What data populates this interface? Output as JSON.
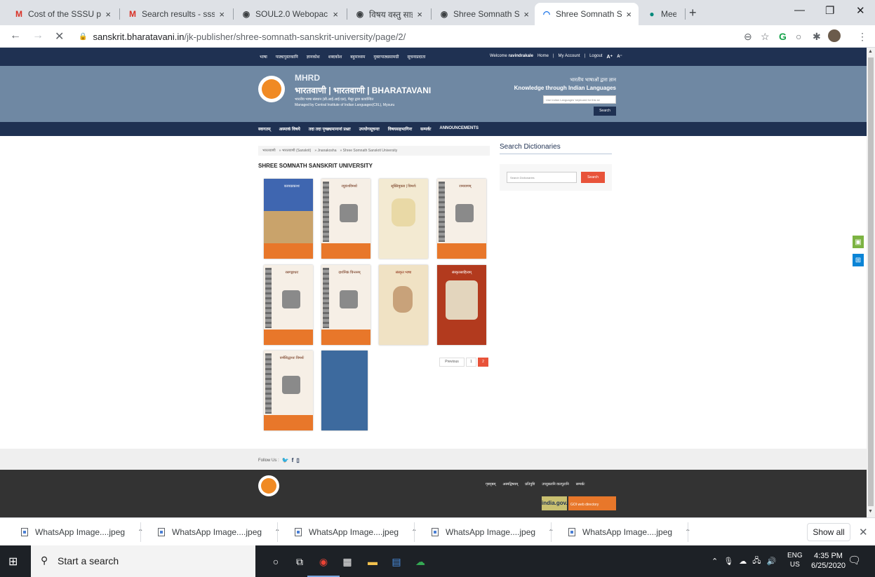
{
  "browser": {
    "tabs": [
      {
        "title": "Cost of the SSSU pu",
        "icon": "gmail-icon"
      },
      {
        "title": "Search results - sssu",
        "icon": "gmail-icon"
      },
      {
        "title": "SOUL2.0 Webopac",
        "icon": "globe-icon"
      },
      {
        "title": "विषय वस्तु साझीदार | C",
        "icon": "globe-icon"
      },
      {
        "title": "Shree Somnath Sans",
        "icon": "globe-icon"
      },
      {
        "title": "Shree Somnath Sans",
        "icon": "loading-icon",
        "active": true
      },
      {
        "title": "Meet – yoi-ngd",
        "icon": "meet-icon"
      }
    ],
    "url_domain": "sanskrit.bharatavani.in",
    "url_path": "/jk-publisher/shree-somnath-sanskrit-university/page/2/",
    "new_tab": "+",
    "close_tab": "×"
  },
  "site": {
    "top_links": [
      "भाषा",
      "पाठ्यपुस्तकानि",
      "ज्ञानकोश",
      "शब्दकोश",
      "बहुमाध्यम",
      "मुक्तपाठ्यसामग्री",
      "सूचनाप्रदाता"
    ],
    "welcome_prefix": "Welcome",
    "username": "ravindrakale",
    "account_links": [
      "Home",
      "|",
      "My Account",
      "|",
      "Logout",
      "A⁺",
      "A⁻"
    ],
    "mhrd": "MHRD",
    "brand_name": "भारतवाणी | भारतवाणी | BHARATAVANI",
    "brand_sub1": "भारतीय भाषा संस्थान (सी.आई.आई.एल), मैसूर द्वारा कार्यान्वित",
    "brand_sub2": "Managed by Central Institute of Indian Languages(CIIL), Mysuru",
    "tagline_hi": "भारतीय भाषाओं द्वारा ज्ञान",
    "tagline_en": "Knowledge through Indian Languages",
    "keyboard_placeholder": "Use Indian Languages' keyboard for this se",
    "search_label": "Search",
    "nav_items": [
      "स्वागतम्",
      "अस्माकं विषये",
      "तदा तदा पृच्छ्यमानानां प्रश्नाः",
      "उपयोगसूचनाः",
      "विषयसहभागिनः",
      "सम्पर्कः",
      "ANNOUNCEMENTS"
    ],
    "breadcrumb": [
      "भारतवाणी",
      "» भारतवाणी (Sanskrit)",
      "» Jnanakosha",
      "» Shree Somnath Sanskrit University"
    ],
    "publisher_title": "SHREE SOMNATH SANSKRIT UNIVERSITY",
    "books": [
      {
        "title": "काव्यप्रकाशः",
        "style": "photo"
      },
      {
        "title": "रघुवंशविमर्शः",
        "style": "pillar"
      },
      {
        "title": "सूक्तिमुक्ता | विमर्शः",
        "style": "map"
      },
      {
        "title": "रामायणम्",
        "style": "pillar"
      },
      {
        "title": "रसगङ्गाधरः",
        "style": "pillar"
      },
      {
        "title": "दार्शनिकं चिन्तनम्",
        "style": "pillar"
      },
      {
        "title": "संस्कृत भाषा",
        "style": "portrait"
      },
      {
        "title": "संस्कृतसाहित्यम्",
        "style": "portrait-red"
      },
      {
        "title": "वर्णसिद्धान्तः विमर्शः",
        "style": "pillar"
      },
      {
        "title": "",
        "style": "blank"
      }
    ],
    "pagination": {
      "previous": "Previous",
      "pages": [
        "1",
        "2"
      ],
      "current": "2"
    },
    "dictionaries_heading": "Search Dictionaries",
    "dictionary_placeholder": "Search Dictionaries",
    "dictionary_button": "Search",
    "follow_label": "Follow Us :",
    "footer_links": [
      "गृष्ठपृष्ठम्",
      "अस्मद्विषयम्",
      "प्रतिपुष्टि",
      "उपयुक्तानि वातपुटानि",
      "सम्पर्कः"
    ],
    "india_gov": "india.gov.in",
    "web_directory": "GOI web directory"
  },
  "downloads": {
    "items": [
      "WhatsApp Image....jpeg",
      "WhatsApp Image....jpeg",
      "WhatsApp Image....jpeg",
      "WhatsApp Image....jpeg",
      "WhatsApp Image....jpeg"
    ],
    "show_all": "Show all"
  },
  "taskbar": {
    "search_placeholder": "Start a search",
    "lang_top": "ENG",
    "lang_bottom": "US",
    "time": "4:35 PM",
    "date": "6/25/2020"
  },
  "colors": {
    "navy": "#1f3152",
    "banner": "#6f88a3",
    "accent_orange": "#e8533a",
    "book_band": "#e8772a"
  }
}
